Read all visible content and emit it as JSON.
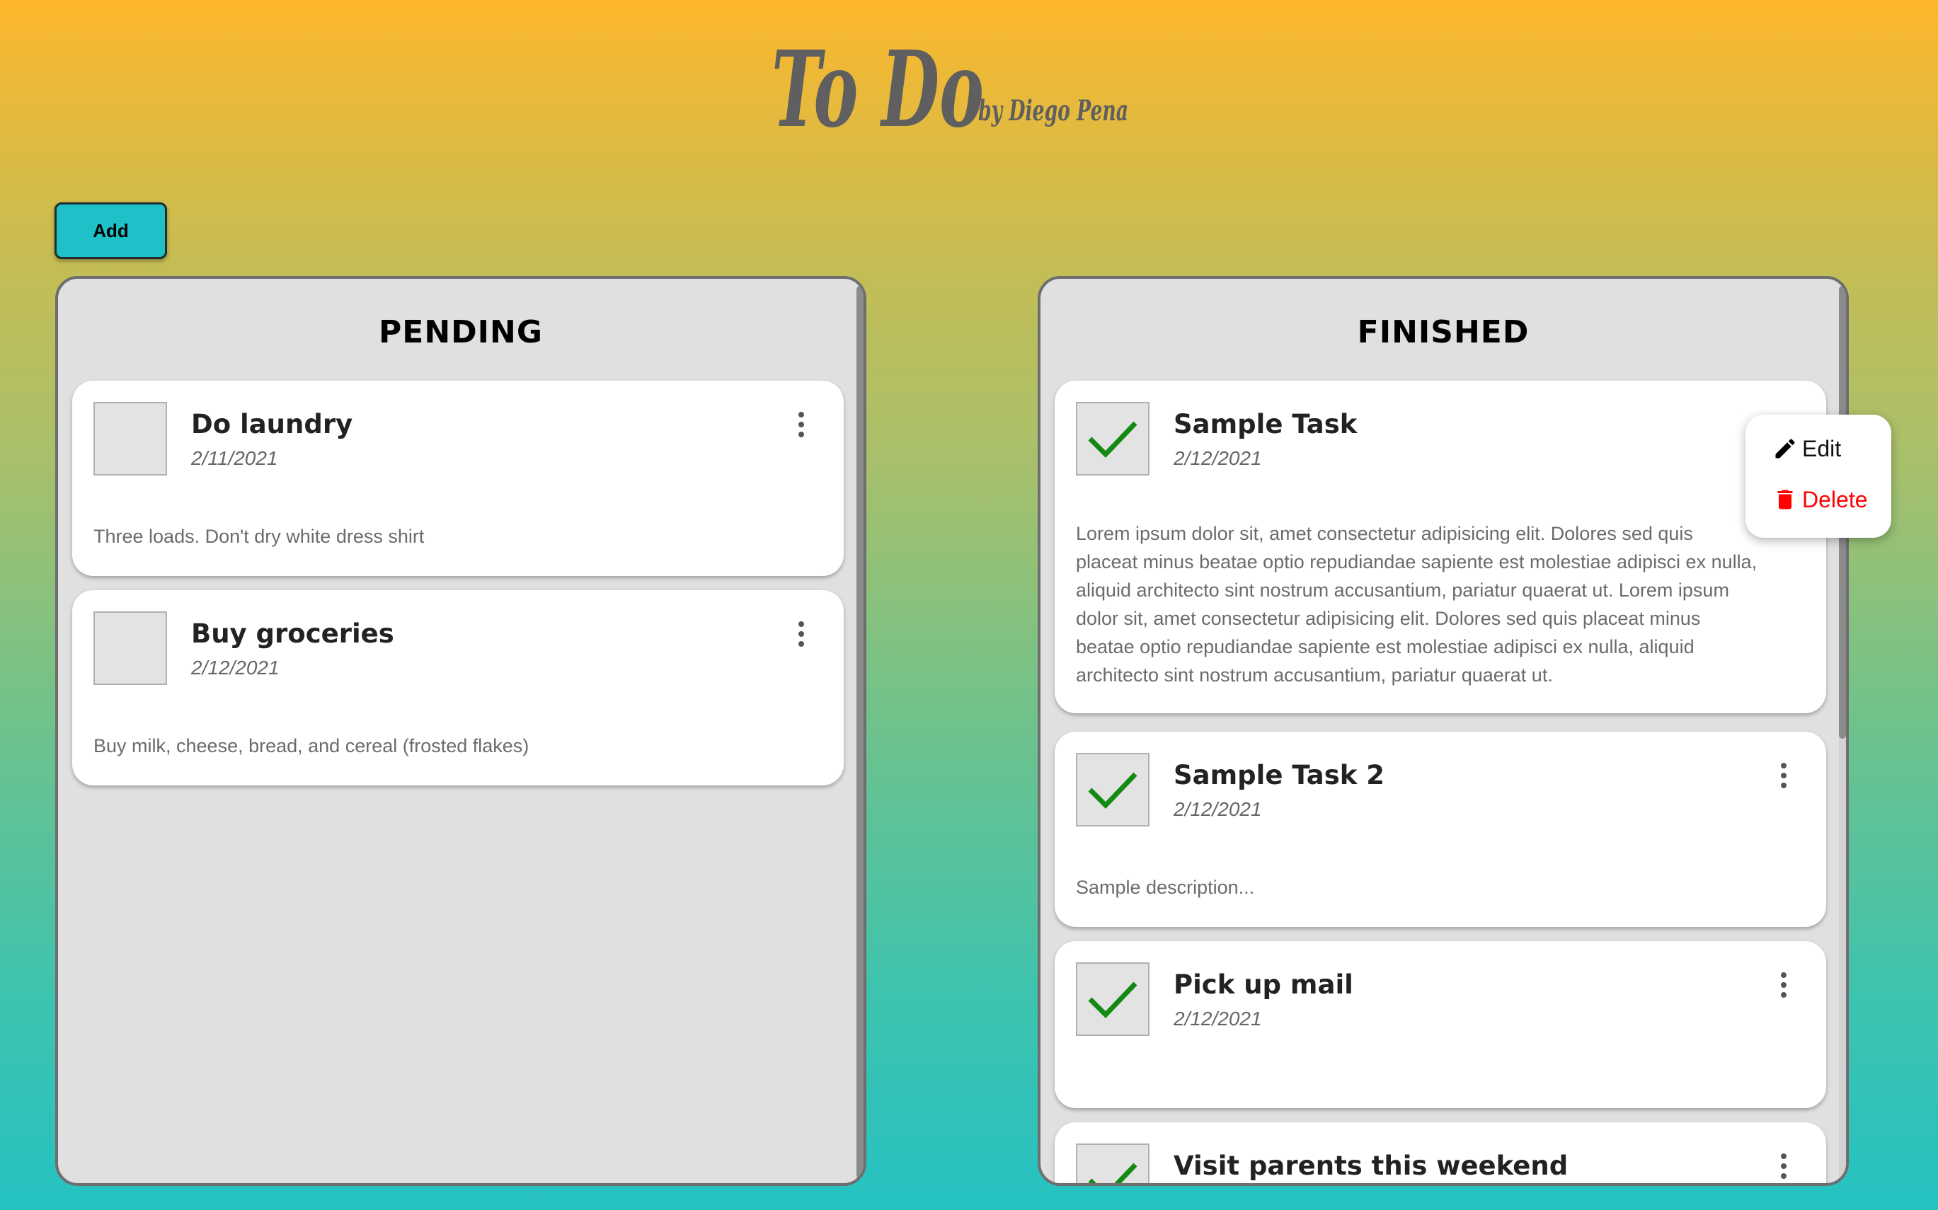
{
  "header": {
    "logo_title": "To Do",
    "logo_byline": "by Diego Pena"
  },
  "toolbar": {
    "add_label": "Add"
  },
  "pending": {
    "title": "PENDING",
    "tasks": [
      {
        "title": "Do laundry",
        "date": "2/11/2021",
        "description": "Three loads. Don't dry white dress shirt",
        "checked": false
      },
      {
        "title": "Buy groceries",
        "date": "2/12/2021",
        "description": "Buy milk, cheese, bread, and cereal (frosted flakes)",
        "checked": false
      }
    ]
  },
  "finished": {
    "title": "FINISHED",
    "tasks": [
      {
        "title": "Sample Task",
        "date": "2/12/2021",
        "description_lines": [
          "Lorem ipsum dolor sit, amet consectetur adipisicing elit. Dolores sed quis",
          "placeat minus beatae optio repudiandae sapiente est molestiae adipisci ex nulla,",
          "aliquid architecto sint nostrum accusantium, pariatur quaerat ut. Lorem ipsum",
          "dolor sit, amet consectetur adipisicing elit. Dolores sed quis placeat minus",
          "beatae optio repudiandae sapiente est molestiae adipisci ex nulla, aliquid",
          "architecto sint nostrum accusantium, pariatur quaerat ut."
        ],
        "checked": true
      },
      {
        "title": "Sample Task 2",
        "date": "2/12/2021",
        "description": "Sample description...",
        "checked": true
      },
      {
        "title": "Pick up mail",
        "date": "2/12/2021",
        "description": "",
        "checked": true
      },
      {
        "title": "Visit parents this weekend",
        "date": "",
        "description": "",
        "checked": true
      }
    ]
  },
  "context_menu": {
    "edit_label": "Edit",
    "delete_label": "Delete",
    "edit_icon": "pencil-icon",
    "delete_icon": "trash-icon",
    "delete_color": "#ff0000"
  },
  "colors": {
    "add_button": "#1fc0c8",
    "check": "#138a13",
    "panel": "#e0e0e0"
  }
}
